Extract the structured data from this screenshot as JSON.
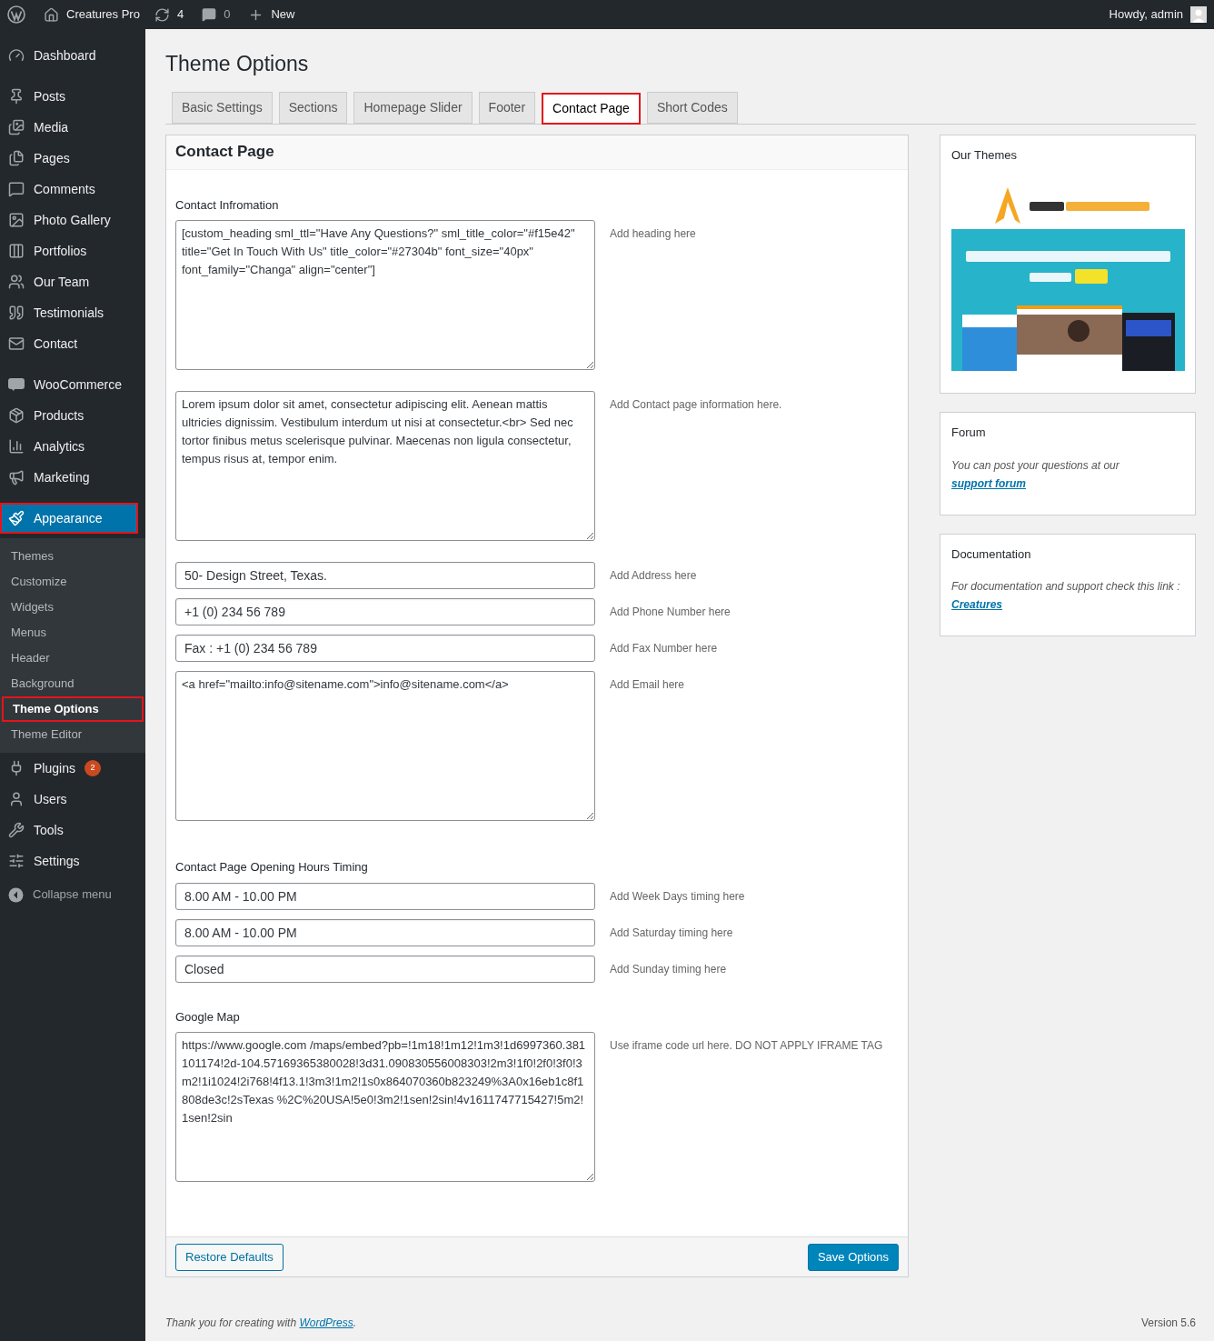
{
  "admin_bar": {
    "site": "Creatures Pro",
    "updates": "4",
    "comments": "0",
    "new": "New",
    "greeting": "Howdy, admin"
  },
  "sidebar": {
    "groups": [
      [
        {
          "label": "Dashboard",
          "kind": "dashboard",
          "selected": false,
          "highlighted": false
        }
      ],
      [
        {
          "label": "Posts",
          "kind": "posts",
          "selected": false,
          "highlighted": false
        },
        {
          "label": "Media",
          "kind": "media",
          "selected": false,
          "highlighted": false
        },
        {
          "label": "Pages",
          "kind": "pages",
          "selected": false,
          "highlighted": false
        },
        {
          "label": "Comments",
          "kind": "comments",
          "selected": false,
          "highlighted": false
        },
        {
          "label": "Photo Gallery",
          "kind": "gallery",
          "selected": false,
          "highlighted": false
        },
        {
          "label": "Portfolios",
          "kind": "portfolio",
          "selected": false,
          "highlighted": false
        },
        {
          "label": "Our Team",
          "kind": "team",
          "selected": false,
          "highlighted": false
        },
        {
          "label": "Testimonials",
          "kind": "quote",
          "selected": false,
          "highlighted": false
        },
        {
          "label": "Contact",
          "kind": "mail",
          "selected": false,
          "highlighted": false
        }
      ],
      [
        {
          "label": "WooCommerce",
          "kind": "woo",
          "selected": false,
          "highlighted": false
        },
        {
          "label": "Products",
          "kind": "products",
          "selected": false,
          "highlighted": false
        },
        {
          "label": "Analytics",
          "kind": "analytics",
          "selected": false,
          "highlighted": false
        },
        {
          "label": "Marketing",
          "kind": "marketing",
          "selected": false,
          "highlighted": false
        }
      ],
      [
        {
          "label": "Appearance",
          "kind": "appearance",
          "selected": true,
          "highlighted": true,
          "children": [
            {
              "label": "Themes",
              "selected": false,
              "highlighted": false
            },
            {
              "label": "Customize",
              "selected": false,
              "highlighted": false
            },
            {
              "label": "Widgets",
              "selected": false,
              "highlighted": false
            },
            {
              "label": "Menus",
              "selected": false,
              "highlighted": false
            },
            {
              "label": "Header",
              "selected": false,
              "highlighted": false
            },
            {
              "label": "Background",
              "selected": false,
              "highlighted": false
            },
            {
              "label": "Theme Options",
              "selected": true,
              "highlighted": true
            },
            {
              "label": "Theme Editor",
              "selected": false,
              "highlighted": false
            }
          ]
        },
        {
          "label": "Plugins",
          "kind": "plugins",
          "selected": false,
          "highlighted": false,
          "badge": "2"
        },
        {
          "label": "Users",
          "kind": "users",
          "selected": false,
          "highlighted": false
        },
        {
          "label": "Tools",
          "kind": "tools",
          "selected": false,
          "highlighted": false
        },
        {
          "label": "Settings",
          "kind": "settings",
          "selected": false,
          "highlighted": false
        }
      ]
    ],
    "collapse": "Collapse menu"
  },
  "page_title": "Theme Options",
  "tabs": [
    {
      "label": "Basic Settings",
      "selected": false
    },
    {
      "label": "Sections",
      "selected": false
    },
    {
      "label": "Homepage Slider",
      "selected": false
    },
    {
      "label": "Footer",
      "selected": false
    },
    {
      "label": "Contact Page",
      "selected": true
    },
    {
      "label": "Short Codes",
      "selected": false
    }
  ],
  "panel": {
    "title": "Contact Page",
    "sections": [
      {
        "heading": "Contact Infromation",
        "fields": [
          {
            "kind": "textarea",
            "value": "[custom_heading sml_ttl=\"Have Any Questions?\" sml_title_color=\"#f15e42\" title=\"Get In Touch With Us\" title_color=\"#27304b\" font_size=\"40px\" font_family=\"Changa\" align=\"center\"]",
            "hint": "Add heading here"
          },
          {
            "kind": "textarea",
            "value": "Lorem ipsum dolor sit amet, consectetur adipiscing elit. Aenean mattis ultricies dignissim. Vestibulum interdum ut nisi at consectetur.<br> Sed nec tortor finibus metus scelerisque pulvinar. Maecenas non ligula consectetur, tempus risus at, tempor enim.",
            "hint": "Add Contact page information here."
          },
          {
            "kind": "input",
            "value": "50- Design Street, Texas.",
            "hint": "Add Address here"
          },
          {
            "kind": "input",
            "value": "+1 (0) 234 56 789",
            "hint": "Add Phone Number here"
          },
          {
            "kind": "input",
            "value": "Fax : +1 (0) 234 56 789",
            "hint": "Add Fax Number here"
          },
          {
            "kind": "textarea",
            "value": "<a href=\"mailto:info@sitename.com\">info@sitename.com</a>",
            "hint": "Add Email here"
          }
        ]
      },
      {
        "heading": "Contact Page Opening Hours Timing",
        "fields": [
          {
            "kind": "input",
            "value": "8.00 AM - 10.00 PM",
            "hint": "Add Week Days timing here"
          },
          {
            "kind": "input",
            "value": "8.00 AM - 10.00 PM",
            "hint": "Add Saturday timing here"
          },
          {
            "kind": "input",
            "value": "Closed",
            "hint": "Add Sunday timing here"
          }
        ]
      },
      {
        "heading": "Google Map",
        "fields": [
          {
            "kind": "url",
            "value": "https://www.google.com /maps/embed?pb=!1m18!1m12!1m3!1d6997360.381101174!2d-104.57169365380028!3d31.090830556008303!2m3!1f0!2f0!3f0!3m2!1i1024!2i768!4f13.1!3m3!1m2!1s0x864070360b823249%3A0x16eb1c8f1808de3c!2sTexas %2C%20USA!5e0!3m2!1sen!2sin!4v1611747715427!5m2!1sen!2sin",
            "hint": "Use iframe code url here. DO NOT APPLY IFRAME TAG"
          }
        ]
      }
    ],
    "restore_button": "Restore Defaults",
    "save_button": "Save Options"
  },
  "widgets": {
    "themes": {
      "title": "Our Themes",
      "kind": "picture"
    },
    "forum": {
      "title": "Forum",
      "text": "You can post your questions at our",
      "link": "support forum"
    },
    "docs": {
      "title": "Documentation",
      "text": "For documentation and support check this link :",
      "link": "Creatures"
    }
  },
  "footer": {
    "text": "Thank you for creating with",
    "link": "WordPress",
    "suffix": ".",
    "version": "Version 5.6"
  }
}
